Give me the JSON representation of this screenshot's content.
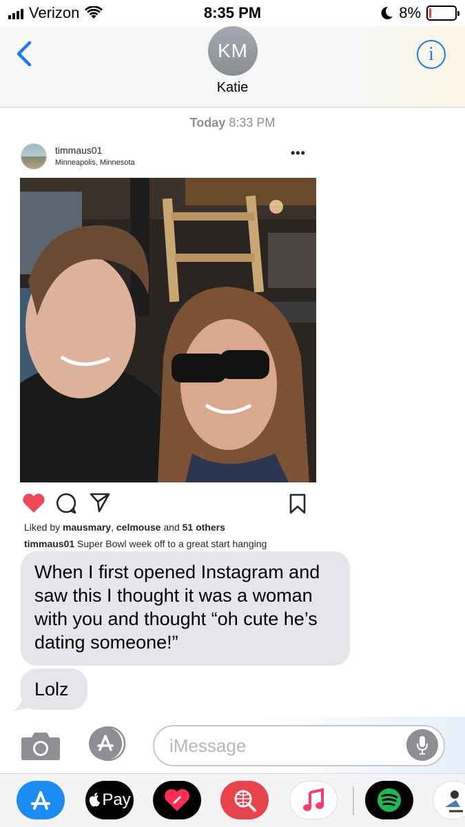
{
  "status_bar": {
    "carrier": "Verizon",
    "time": "8:35 PM",
    "battery_percent": "8%",
    "battery_level": 0.08
  },
  "header": {
    "contact_initials": "KM",
    "contact_name": "Katie",
    "info_icon_text": "i"
  },
  "thread": {
    "timestamp_day": "Today",
    "timestamp_time": "8:33 PM"
  },
  "instagram_post": {
    "username": "timmaus01",
    "location": "Minneapolis, Minnesota",
    "more": "•••",
    "likes_prefix": "Liked by ",
    "liked_by_1": "mausmary",
    "likes_sep": ", ",
    "liked_by_2": "celmouse",
    "likes_and": " and ",
    "likes_others": "51 others",
    "caption_user": "timmaus01",
    "caption_text": " Super Bowl week off to a great start hanging"
  },
  "messages": [
    {
      "text": "When I first opened Instagram and saw this I thought it was a woman with you and thought “oh cute he’s dating someone!”"
    },
    {
      "text": "Lolz"
    }
  ],
  "composer": {
    "placeholder": "iMessage"
  },
  "app_drawer": {
    "apple_pay_label": "Pay",
    "apps": [
      "app-store-icon",
      "apple-pay-icon",
      "digital-touch-icon",
      "web-images-icon",
      "music-icon",
      "spotify-icon",
      "sticker-app-icon"
    ]
  },
  "colors": {
    "ios_blue": "#1a7cf5",
    "bubble_gray": "#e5e5ea",
    "battery_red": "#ff3b30",
    "ig_heart": "#ed4956",
    "spotify_green": "#1db954"
  }
}
